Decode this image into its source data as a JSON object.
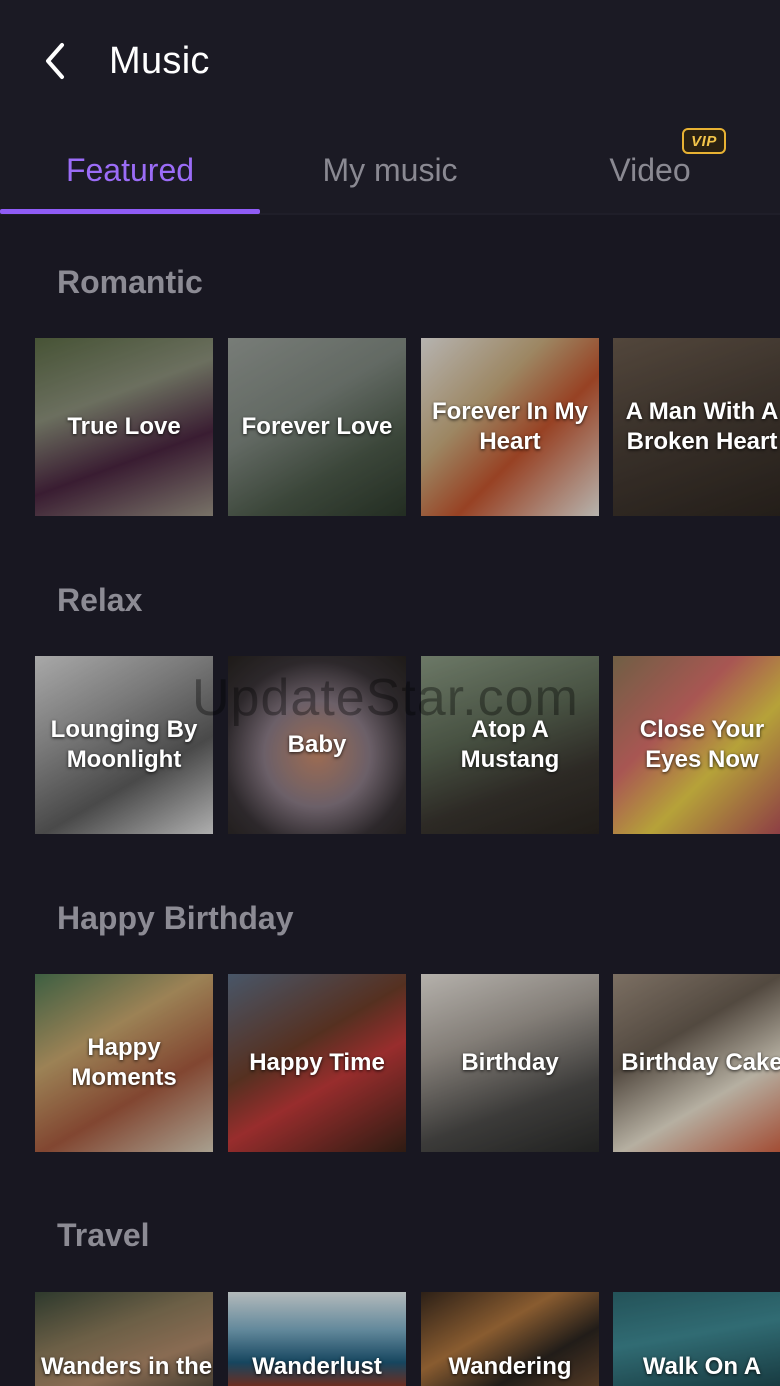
{
  "header": {
    "title": "Music",
    "back_icon": "chevron-left-icon"
  },
  "tabs": [
    {
      "label": "Featured",
      "active": true
    },
    {
      "label": "My music",
      "active": false
    },
    {
      "label": "Video",
      "active": false,
      "badge": "VIP"
    }
  ],
  "colors": {
    "accent": "#8f5cf6",
    "vip": "#e8b233",
    "background": "#181721"
  },
  "sections": [
    {
      "title": "Romantic",
      "cards": [
        {
          "label": "True Love",
          "bg": "linear-gradient(160deg,#5b6b45 0%,#8a8f7a 35%,#4a2540 65%,#9a9385 100%)"
        },
        {
          "label": "Forever Love",
          "bg": "linear-gradient(150deg,#9aa09a 0%,#7e877f 40%,#4c5a4a 70%,#2d3a2c 100%)"
        },
        {
          "label": "Forever In My Heart",
          "bg": "linear-gradient(135deg,#e9e6e2 0%,#c9ad7f 35%,#c2542e 60%,#eae6df 100%)"
        },
        {
          "label": "A Man With A Broken Heart",
          "bg": "linear-gradient(160deg,#6a5b4d 0%,#4a3f36 45%,#2d2620 100%)"
        }
      ]
    },
    {
      "title": "Relax",
      "cards": [
        {
          "label": "Lounging By Moonlight",
          "bg": "linear-gradient(150deg,#d8d8d8 0%,#9a9a9a 35%,#5e5e5e 65%,#e0e0e0 100%)"
        },
        {
          "label": "Baby",
          "bg": "radial-gradient(circle at 50% 55%,#c98a6a 0%,#8a7b86 40%,#3a3438 70%,#26221f 100%)"
        },
        {
          "label": "Atop A Mustang",
          "bg": "linear-gradient(160deg,#8b9b84 0%,#5d6a56 40%,#3a3630 70%,#2a2520 100%)"
        },
        {
          "label": "Close Your Eyes Now",
          "bg": "linear-gradient(135deg,#8f7a58 0%,#d86f6a 35%,#e9d04a 60%,#b1455a 100%)"
        }
      ]
    },
    {
      "title": "Happy Birthday",
      "cards": [
        {
          "label": "Happy Moments",
          "bg": "linear-gradient(150deg,#4f7a55 0%,#c8a76e 35%,#a65a3f 65%,#d8cdb8 100%)"
        },
        {
          "label": "Happy Time",
          "bg": "linear-gradient(150deg,#5d6f86 0%,#6e3e2a 40%,#c33a3a 60%,#3b2418 100%)"
        },
        {
          "label": "Birthday",
          "bg": "linear-gradient(160deg,#e8e3dc 0%,#a9a29a 35%,#4d4c4a 70%,#2a2b2a 100%)"
        },
        {
          "label": "Birthday Cake",
          "bg": "linear-gradient(150deg,#9f8f7f 0%,#6a5e52 35%,#e9e1cf 65%,#cf5a3a 100%)"
        }
      ]
    },
    {
      "title": "Travel",
      "cards": [
        {
          "label": "Wanders in the",
          "bg": "linear-gradient(160deg,#3b4a3a 0%,#8a7a5a 40%,#b08a6a 70%,#5a5040 100%)"
        },
        {
          "label": "Wanderlust",
          "bg": "linear-gradient(180deg,#e6eef0 0%,#7fb0c8 40%,#1d5a7a 75%,#8b3a2a 100%)"
        },
        {
          "label": "Wandering",
          "bg": "linear-gradient(150deg,#3a2a1e 0%,#b0763e 40%,#2b2520 70%,#6a4a30 100%)"
        },
        {
          "label": "Walk On A",
          "bg": "linear-gradient(170deg,#2e6a72 0%,#3f8a94 45%,#1e4a52 100%)"
        }
      ]
    }
  ],
  "watermark": "UpdateStar.com"
}
